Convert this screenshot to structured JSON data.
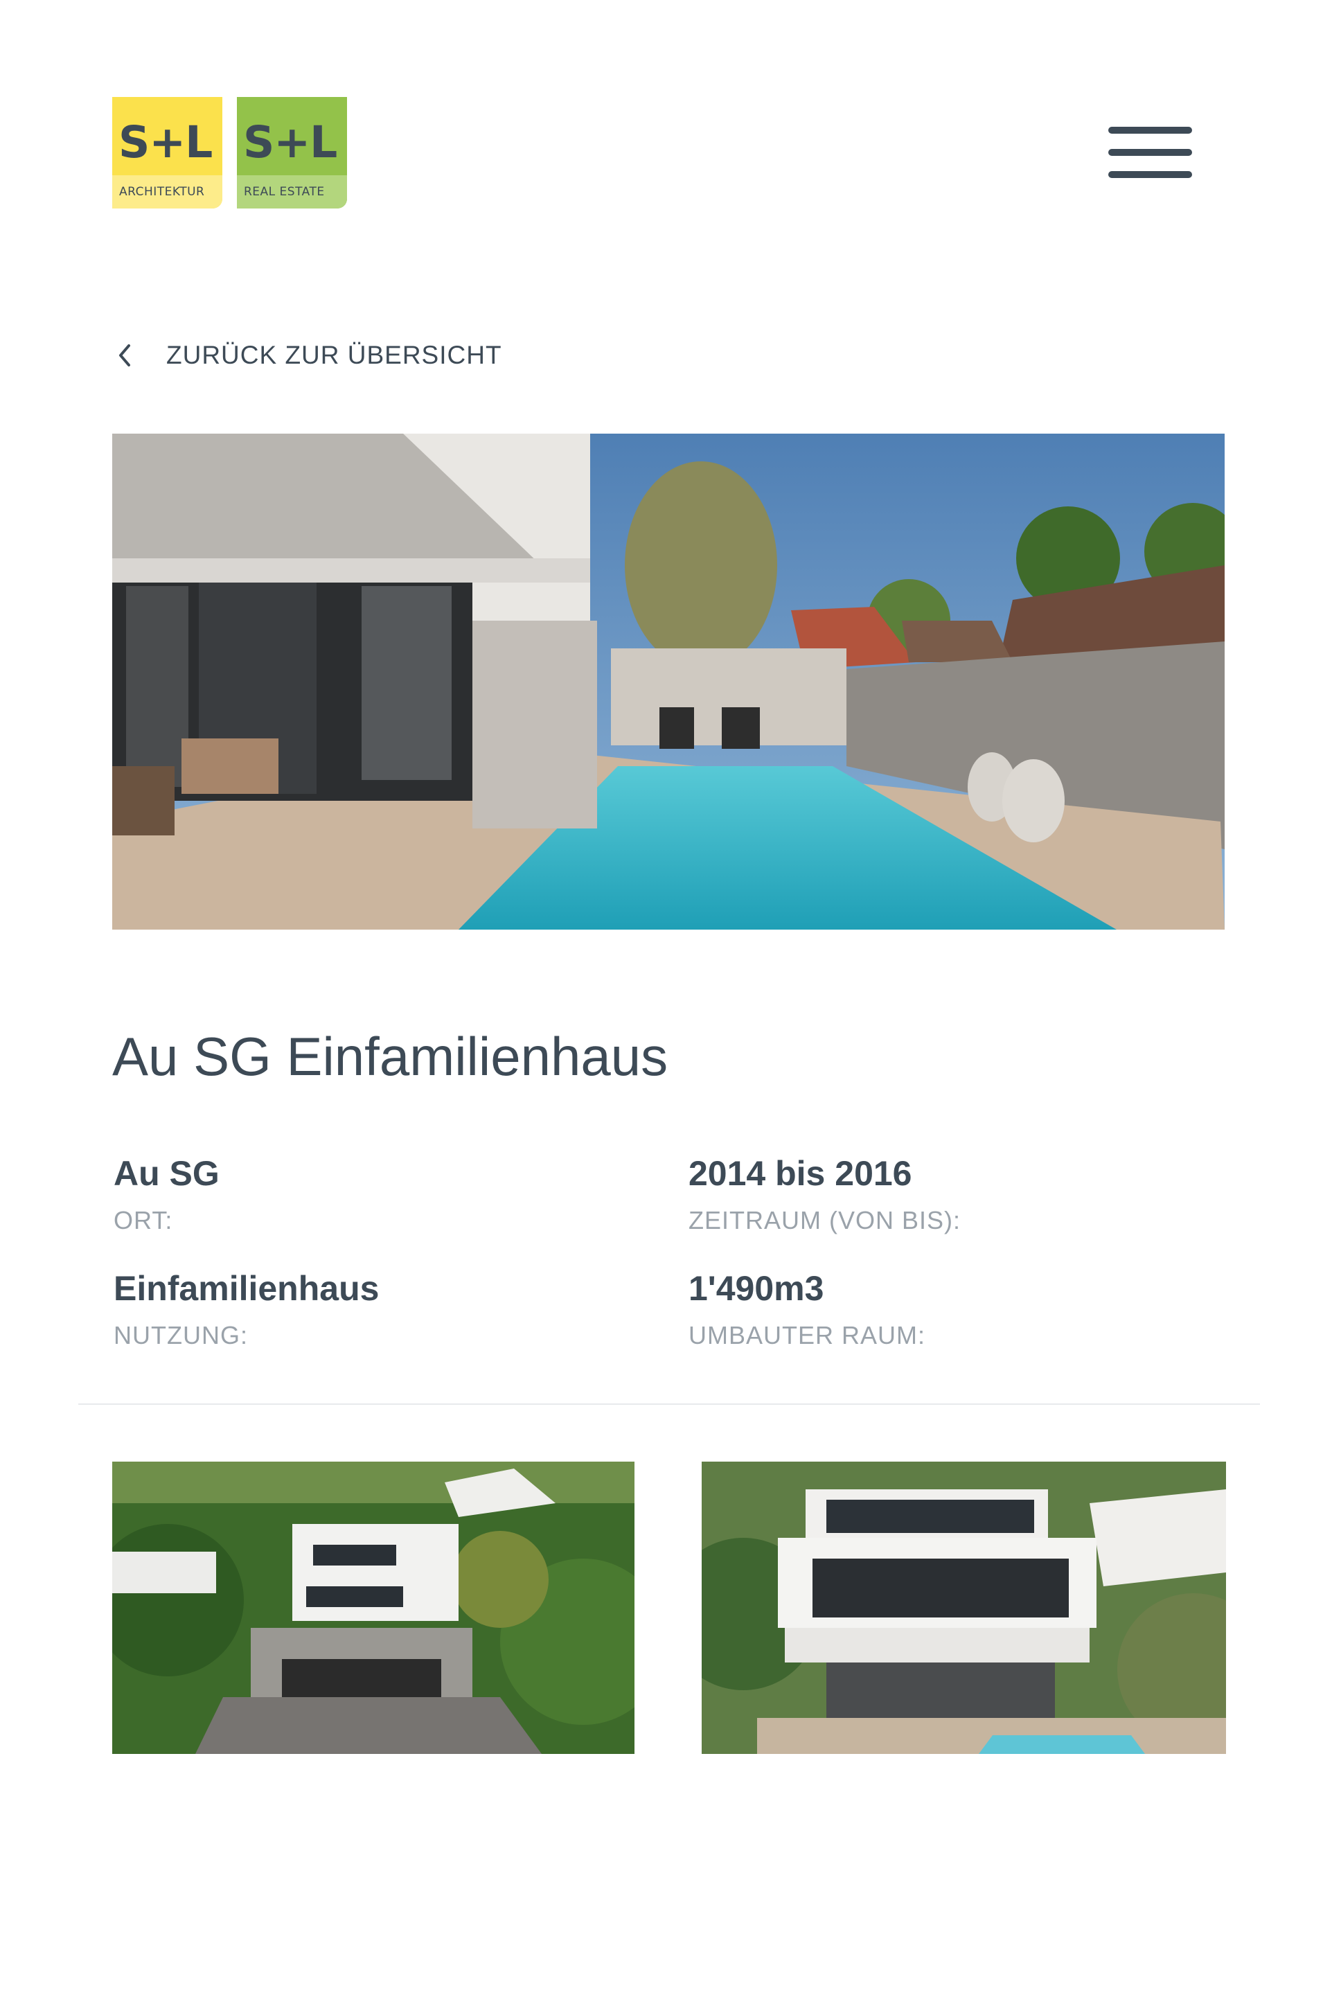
{
  "header": {
    "logo_architektur": {
      "mark": "S+L",
      "sub": "ARCHITEKTUR",
      "color": "#fbe14c"
    },
    "logo_real_estate": {
      "mark": "S+L",
      "sub": "REAL ESTATE",
      "color": "#93c24a"
    },
    "menu_icon": "hamburger-menu-icon"
  },
  "nav": {
    "back_label": "ZURÜCK ZUR ÜBERSICHT",
    "back_icon": "chevron-left-icon"
  },
  "project": {
    "title": "Au SG Einfamilienhaus",
    "facts": [
      {
        "value": "Au SG",
        "key": "ORT:"
      },
      {
        "value": "2014 bis 2016",
        "key": "ZEITRAUM (VON BIS):"
      },
      {
        "value": "Einfamilienhaus",
        "key": "NUTZUNG:"
      },
      {
        "value": "1'490m3",
        "key": "UMBAUTER RAUM:"
      }
    ]
  },
  "colors": {
    "text": "#3d4a56",
    "muted": "#9aa2aa",
    "pool": "#3fb7c9"
  }
}
